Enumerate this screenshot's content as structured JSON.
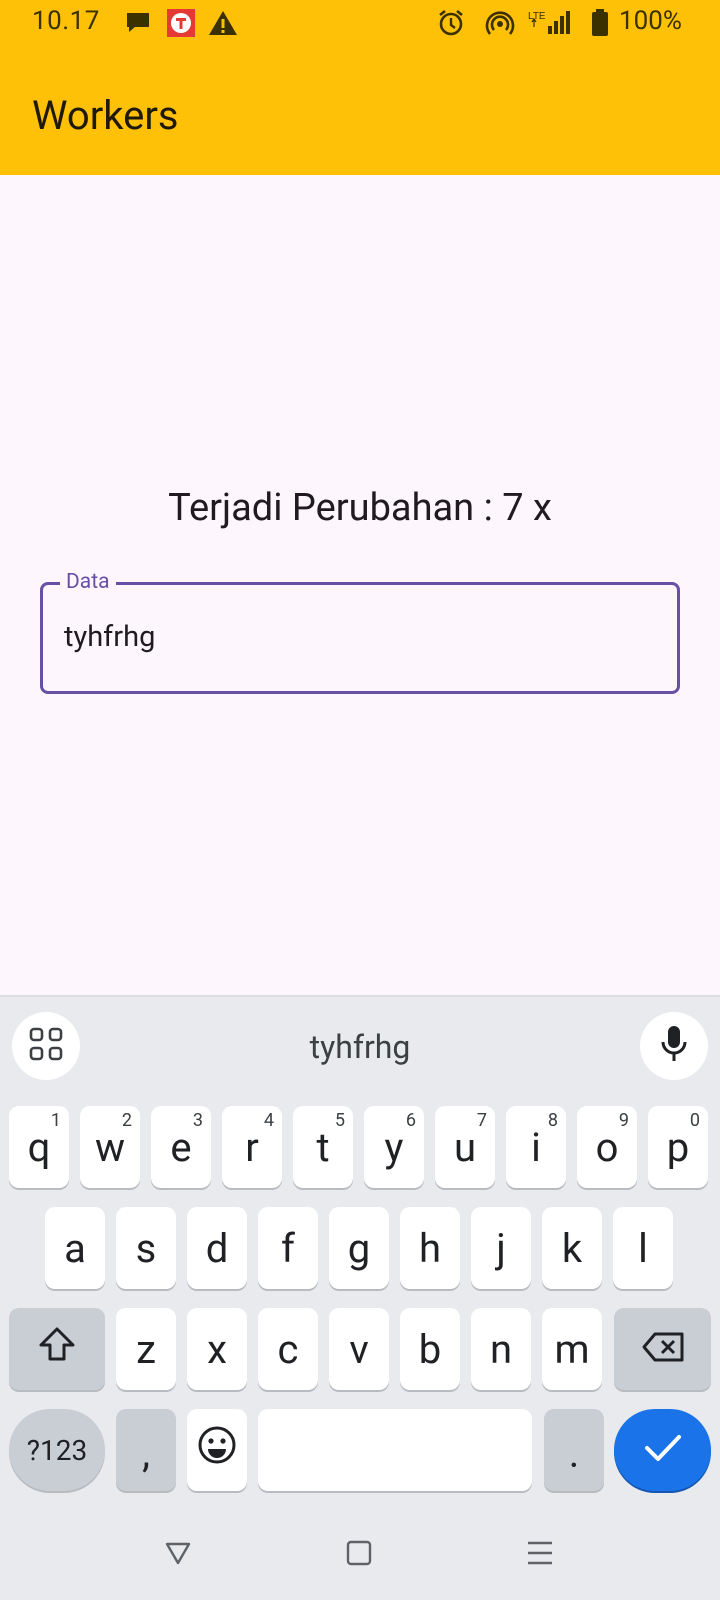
{
  "status_bar": {
    "time": "10.17",
    "battery": "100%",
    "icons": [
      "chat-icon",
      "app-notification-icon",
      "warning-icon",
      "alarm-icon",
      "hotspot-icon",
      "lte-signal-icon",
      "battery-icon"
    ]
  },
  "app_bar": {
    "title": "Workers",
    "color": "#ffc107"
  },
  "main": {
    "counter_text": "Terjadi Perubahan : 7 x",
    "field": {
      "label": "Data",
      "value": "tyhfrhg",
      "accent": "#6750a4"
    }
  },
  "keyboard": {
    "suggestion": "tyhfrhg",
    "row1": [
      {
        "label": "q",
        "hint": "1"
      },
      {
        "label": "w",
        "hint": "2"
      },
      {
        "label": "e",
        "hint": "3"
      },
      {
        "label": "r",
        "hint": "4"
      },
      {
        "label": "t",
        "hint": "5"
      },
      {
        "label": "y",
        "hint": "6"
      },
      {
        "label": "u",
        "hint": "7"
      },
      {
        "label": "i",
        "hint": "8"
      },
      {
        "label": "o",
        "hint": "9"
      },
      {
        "label": "p",
        "hint": "0"
      }
    ],
    "row2": [
      "a",
      "s",
      "d",
      "f",
      "g",
      "h",
      "j",
      "k",
      "l"
    ],
    "row3": [
      "z",
      "x",
      "c",
      "v",
      "b",
      "n",
      "m"
    ],
    "symbols_label": "?123",
    "comma": ",",
    "period": ".",
    "enter_color": "#1a73e8"
  }
}
